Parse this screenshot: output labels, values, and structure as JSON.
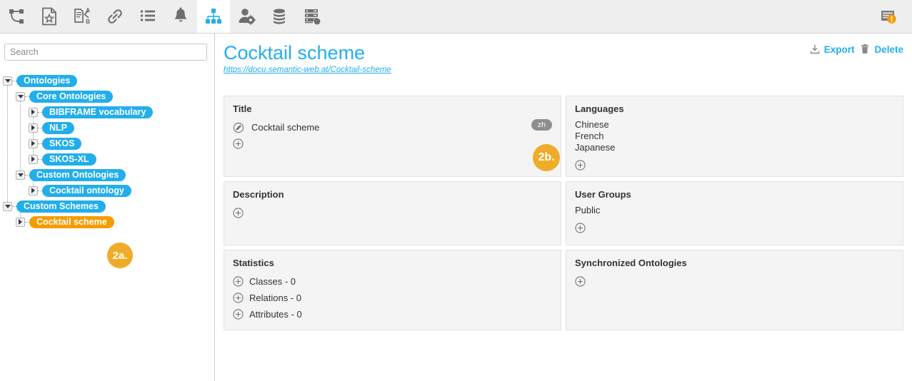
{
  "toolbar": {
    "items": [
      {
        "icon": "project-graph-icon",
        "name": "toolbar-project-graph",
        "active": false
      },
      {
        "icon": "document-star-icon",
        "name": "toolbar-document-star",
        "active": false
      },
      {
        "icon": "document-translate-icon",
        "name": "toolbar-document-translate",
        "active": false
      },
      {
        "icon": "link-icon",
        "name": "toolbar-link",
        "active": false
      },
      {
        "icon": "list-icon",
        "name": "toolbar-list",
        "active": false
      },
      {
        "icon": "bell-icon",
        "name": "toolbar-bell",
        "active": false
      },
      {
        "icon": "hierarchy-icon",
        "name": "toolbar-hierarchy",
        "active": true
      },
      {
        "icon": "user-settings-icon",
        "name": "toolbar-user-settings",
        "active": false
      },
      {
        "icon": "database-icon",
        "name": "toolbar-database",
        "active": false
      },
      {
        "icon": "server-settings-icon",
        "name": "toolbar-server-settings",
        "active": false
      }
    ],
    "notifications": {
      "icon": "log-warning-icon",
      "name": "toolbar-log-warning"
    }
  },
  "colors": {
    "accent": "#22aeec",
    "node_orange": "#f59c00",
    "marker_orange": "#eeac28",
    "warning_orange": "#f99b00",
    "panel_bg": "#f4f4f4",
    "toolbar_bg": "#eeeeee",
    "badge_gray": "#8e8e8e"
  },
  "sidebar": {
    "search": {
      "value": "",
      "placeholder": "Search"
    },
    "tree": [
      {
        "label": "Ontologies",
        "depth": 0,
        "expanded": true,
        "selected": false
      },
      {
        "label": "Core Ontologies",
        "depth": 1,
        "expanded": true,
        "selected": false
      },
      {
        "label": "BIBFRAME vocabulary",
        "depth": 2,
        "expanded": false,
        "selected": false
      },
      {
        "label": "NLP",
        "depth": 2,
        "expanded": false,
        "selected": false
      },
      {
        "label": "SKOS",
        "depth": 2,
        "expanded": false,
        "selected": false
      },
      {
        "label": "SKOS-XL",
        "depth": 2,
        "expanded": false,
        "selected": false
      },
      {
        "label": "Custom Ontologies",
        "depth": 1,
        "expanded": true,
        "selected": false
      },
      {
        "label": "Cocktail ontology",
        "depth": 2,
        "expanded": false,
        "selected": false
      },
      {
        "label": "Custom Schemes",
        "depth": 0,
        "expanded": true,
        "selected": false
      },
      {
        "label": "Cocktail scheme",
        "depth": 1,
        "expanded": false,
        "selected": true
      }
    ]
  },
  "markers": [
    {
      "label": "2a.",
      "name": "annotation-marker-2a"
    },
    {
      "label": "2b.",
      "name": "annotation-marker-2b"
    }
  ],
  "main": {
    "title": "Cocktail scheme",
    "url": "https://docu.semantic-web.at/Cocktail-scheme",
    "actions": [
      {
        "label": "Export",
        "icon": "download-icon",
        "name": "export-button"
      },
      {
        "label": "Delete",
        "icon": "trash-icon",
        "name": "delete-button"
      }
    ],
    "panels": {
      "title": {
        "heading": "Title",
        "value": "Cocktail scheme",
        "language_badge": "zh"
      },
      "languages": {
        "heading": "Languages",
        "items": [
          "Chinese",
          "French",
          "Japanese"
        ]
      },
      "description": {
        "heading": "Description",
        "items": []
      },
      "user_groups": {
        "heading": "User Groups",
        "items": [
          "Public"
        ]
      },
      "statistics": {
        "heading": "Statistics",
        "items": [
          "Classes - 0",
          "Relations - 0",
          "Attributes - 0"
        ]
      },
      "synchronized_ontologies": {
        "heading": "Synchronized Ontologies",
        "items": []
      }
    }
  }
}
